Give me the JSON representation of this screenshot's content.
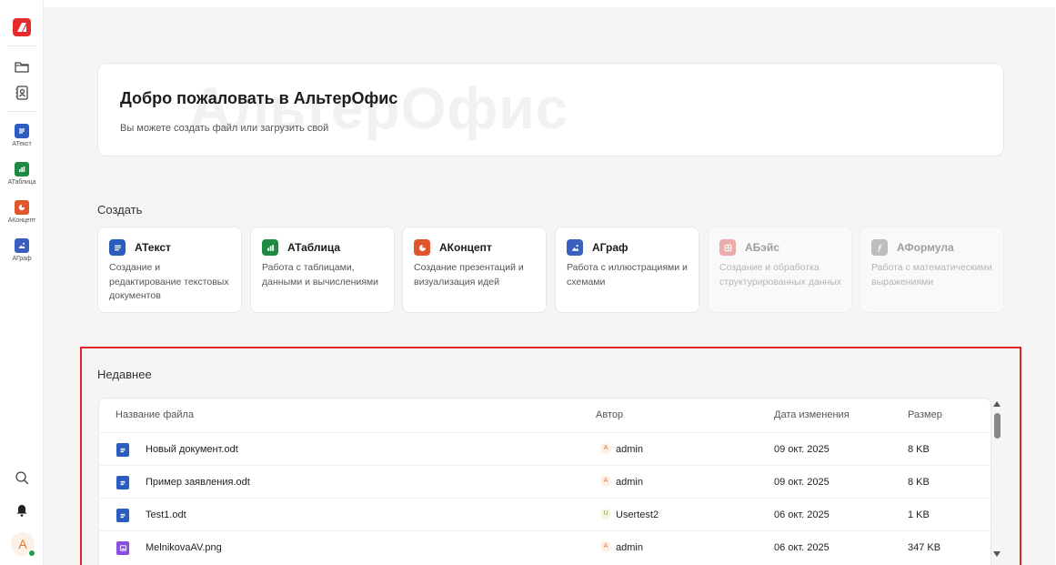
{
  "sidebar": {
    "nav_icons": [
      "folder-icon",
      "contacts-icon"
    ],
    "apps": [
      {
        "label": "АТекст",
        "color": "#2b5cbf",
        "icon": "text-doc-icon"
      },
      {
        "label": "АТаблица",
        "color": "#1f8a43",
        "icon": "spreadsheet-icon"
      },
      {
        "label": "АКонцепт",
        "color": "#e0552b",
        "icon": "presentation-icon"
      },
      {
        "label": "АГраф",
        "color": "#3b5fc0",
        "icon": "graphics-icon"
      }
    ],
    "bottom_icons": [
      "search-icon",
      "bell-icon"
    ],
    "avatar_letter": "A"
  },
  "welcome": {
    "title": "Добро пожаловать в АльтерОфис",
    "subtitle": "Вы можете создать файл или загрузить свой",
    "watermark": "АльтерОфис"
  },
  "create": {
    "title": "Создать",
    "cards": [
      {
        "name": "АТекст",
        "desc": "Создание и редактирование текстовых документов",
        "color": "#2b5cbf",
        "enabled": true
      },
      {
        "name": "АТаблица",
        "desc": "Работа с таблицами, данными и вычислениями",
        "color": "#1f8a43",
        "enabled": true
      },
      {
        "name": "АКонцепт",
        "desc": "Создание презентаций и визуализация идей",
        "color": "#e0552b",
        "enabled": true
      },
      {
        "name": "АГраф",
        "desc": "Работа с иллюстрациями и схемами",
        "color": "#3b5fc0",
        "enabled": true
      },
      {
        "name": "АБэйс",
        "desc": "Создание и обработка структурированных данных",
        "color": "#d9413a",
        "enabled": false
      },
      {
        "name": "АФормула",
        "desc": "Работа с математическими выражениями",
        "color": "#6b6b6b",
        "enabled": false
      }
    ]
  },
  "recent": {
    "title": "Недавнее",
    "columns": {
      "name": "Название файла",
      "author": "Автор",
      "date": "Дата изменения",
      "size": "Размер"
    },
    "rows": [
      {
        "name": "Новый документ.odt",
        "author": "admin",
        "author_initial": "A",
        "date": "09 окт. 2025",
        "size": "8 KB",
        "type": "text"
      },
      {
        "name": "Пример заявления.odt",
        "author": "admin",
        "author_initial": "A",
        "date": "09 окт. 2025",
        "size": "8 KB",
        "type": "text"
      },
      {
        "name": "Test1.odt",
        "author": "Usertest2",
        "author_initial": "U",
        "date": "06 окт. 2025",
        "size": "1 KB",
        "type": "text"
      },
      {
        "name": "MelnikovaAV.png",
        "author": "admin",
        "author_initial": "A",
        "date": "06 окт. 2025",
        "size": "347 KB",
        "type": "image"
      }
    ]
  },
  "colors": {
    "accent_red": "#e52b2b",
    "highlight_border": "#e0262b",
    "online_green": "#1e9b4b"
  }
}
